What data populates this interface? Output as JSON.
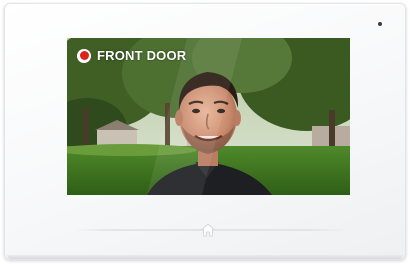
{
  "intercom": {
    "camera_label": "FRONT DOOR",
    "recording_indicator": "record-icon",
    "home_icon": "home-icon",
    "accent_color": "#e0201c"
  }
}
